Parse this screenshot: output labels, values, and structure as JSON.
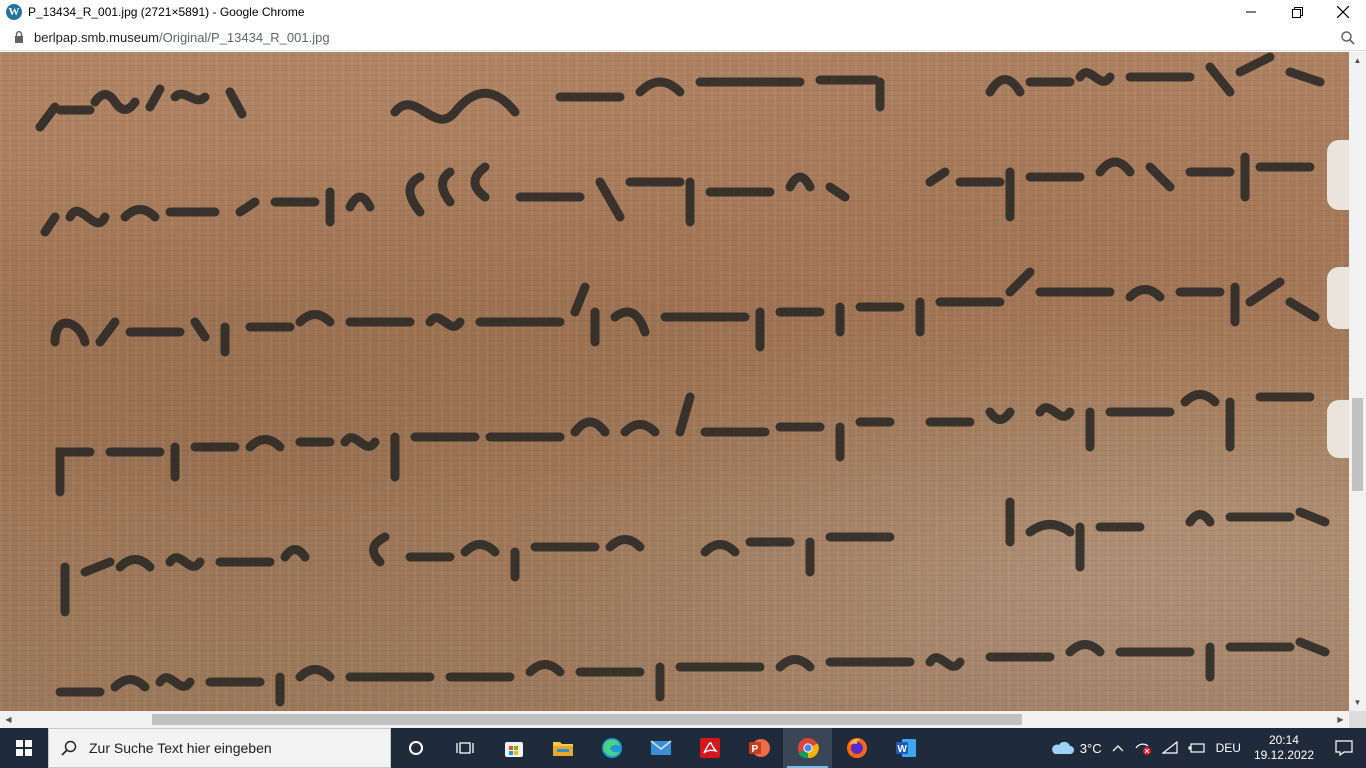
{
  "window": {
    "app_icon": "wordpress-icon",
    "title": "P_13434_R_001.jpg (2721×5891) - Google Chrome",
    "controls": [
      "minimize-icon",
      "restore-icon",
      "close-icon"
    ]
  },
  "address_bar": {
    "host": "berlpap.smb.museum",
    "path": "/Original/P_13434_R_001.jpg",
    "lock_icon": "lock-icon",
    "zoom_icon": "zoom-icon"
  },
  "viewport": {
    "content": "papyrus-image",
    "vertical_scroll_fraction": 0.55,
    "horizontal_scroll_fraction": 0.13
  },
  "taskbar": {
    "search_placeholder": "Zur Suche Text hier eingeben",
    "apps": [
      {
        "name": "cortana-icon",
        "active": false
      },
      {
        "name": "task-view-icon",
        "active": false
      },
      {
        "name": "microsoft-store-icon",
        "active": false
      },
      {
        "name": "file-explorer-icon",
        "active": false
      },
      {
        "name": "edge-icon",
        "active": false
      },
      {
        "name": "mail-icon",
        "active": false
      },
      {
        "name": "acrobat-icon",
        "active": false
      },
      {
        "name": "powerpoint-icon",
        "active": false
      },
      {
        "name": "chrome-icon",
        "active": true
      },
      {
        "name": "firefox-icon",
        "active": false
      },
      {
        "name": "word-icon",
        "active": false
      }
    ],
    "weather": {
      "icon": "cloud-icon",
      "temp": "3°C"
    },
    "language": "DEU",
    "time": "20:14",
    "date": "19.12.2022"
  },
  "colors": {
    "taskbar_bg": "#1f2b3a",
    "papyrus": "#a9805f",
    "ink": "#2b2b2b",
    "chrome_accent": "#76b9ed"
  }
}
